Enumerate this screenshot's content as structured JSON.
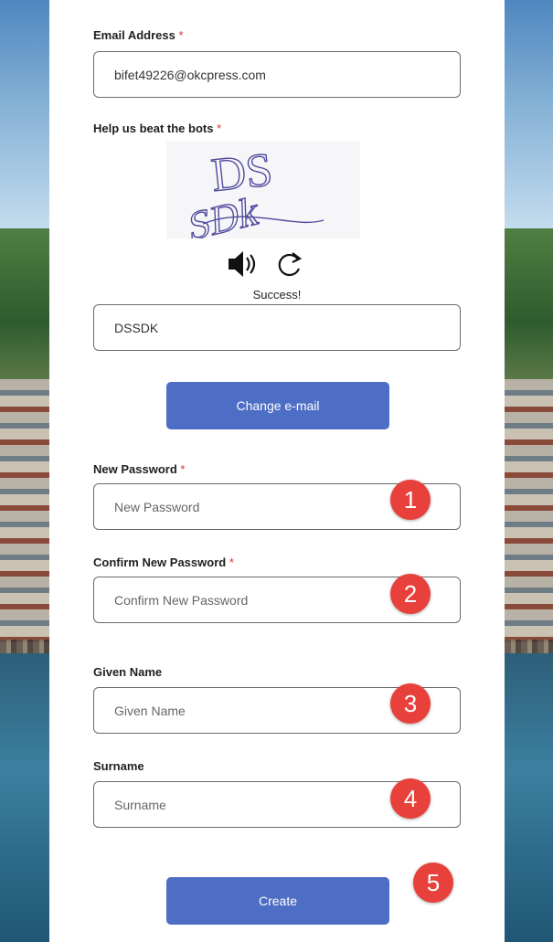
{
  "email": {
    "label": "Email Address",
    "required": "*",
    "value": "bifet49226@okcpress.com"
  },
  "captcha": {
    "label": "Help us beat the bots",
    "required": "*",
    "image_text": "DSSDk",
    "audio_icon": "speaker-icon",
    "refresh_icon": "refresh-icon",
    "status": "Success!",
    "value": "DSSDK"
  },
  "change_email_button": {
    "label": "Change e-mail"
  },
  "new_password": {
    "label": "New Password",
    "required": "*",
    "placeholder": "New Password"
  },
  "confirm_password": {
    "label": "Confirm New Password",
    "required": "*",
    "placeholder": "Confirm New Password"
  },
  "given_name": {
    "label": "Given Name",
    "placeholder": "Given Name"
  },
  "surname": {
    "label": "Surname",
    "placeholder": "Surname"
  },
  "create_button": {
    "label": "Create"
  },
  "annotations": [
    "1",
    "2",
    "3",
    "4",
    "5"
  ],
  "colors": {
    "button": "#4e6dc4",
    "badge": "#e8413b",
    "required": "#d13438"
  }
}
